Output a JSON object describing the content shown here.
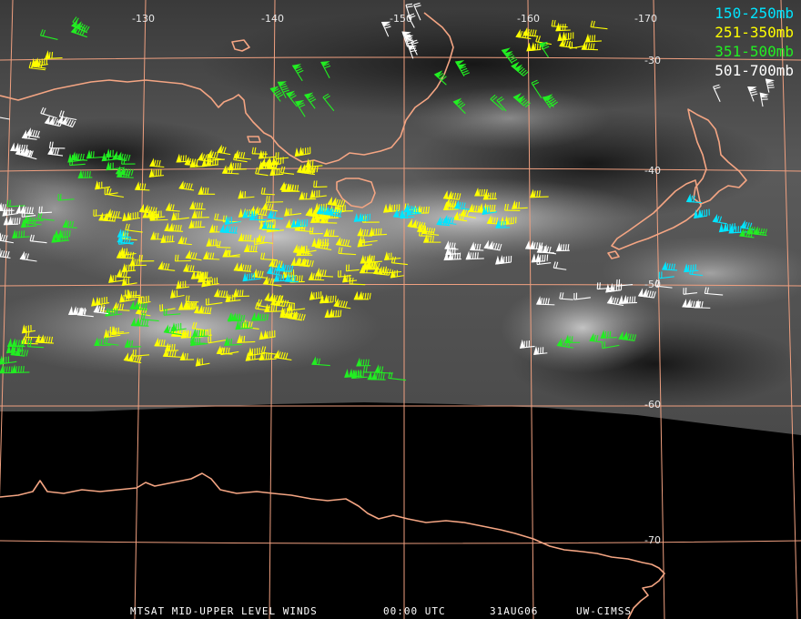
{
  "colors": {
    "grid": "#f0a080",
    "coast": "#f4a583",
    "cyan": "#00e5ff",
    "yellow": "#ffff00",
    "green": "#22ee22",
    "white": "#ffffff"
  },
  "legend": [
    {
      "label": "150-250mb",
      "color": "#00e5ff"
    },
    {
      "label": "251-350mb",
      "color": "#ffff00"
    },
    {
      "label": "351-500mb",
      "color": "#22ee22"
    },
    {
      "label": "501-700mb",
      "color": "#ffffff"
    }
  ],
  "longitude_labels": [
    "-130",
    "-140",
    "-150",
    "-160",
    "-170"
  ],
  "latitude_labels": [
    "-30",
    "-40",
    "-50",
    "-60",
    "-70"
  ],
  "footer": {
    "product": "MTSAT MID-UPPER LEVEL WINDS",
    "time": "00:00 UTC",
    "date": "31AUG06",
    "source": "UW-CIMSS"
  }
}
